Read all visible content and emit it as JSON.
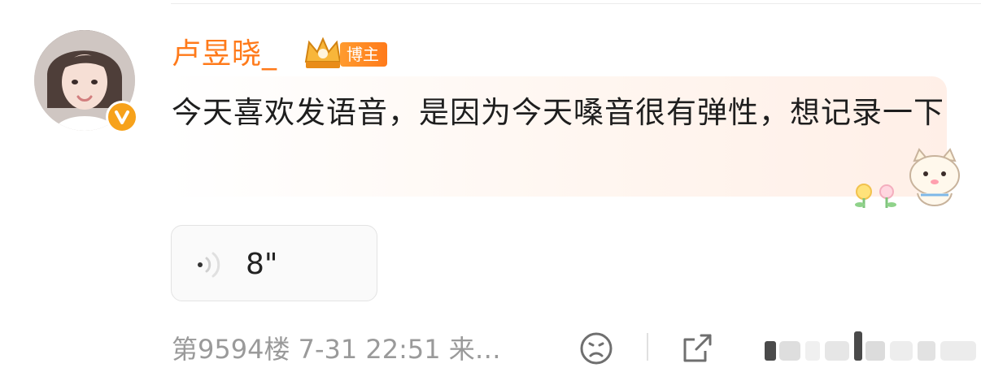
{
  "comment": {
    "username": "卢昱晓_",
    "badge_label": "博主",
    "text": "今天喜欢发语音，是因为今天嗓音很有弹性，想记录一下",
    "voice": {
      "duration": "8\""
    },
    "meta": "第9594楼 7-31 22:51 来…",
    "colors": {
      "username": "#ff7a1a",
      "badge": "#ff8a24",
      "verified": "#f7a21b"
    },
    "icons": [
      "avatar",
      "verified-badge-icon",
      "crown-icon",
      "cat-sticker-icon",
      "voice-wave-icon",
      "emoji-icon",
      "share-icon",
      "like-icon"
    ]
  }
}
